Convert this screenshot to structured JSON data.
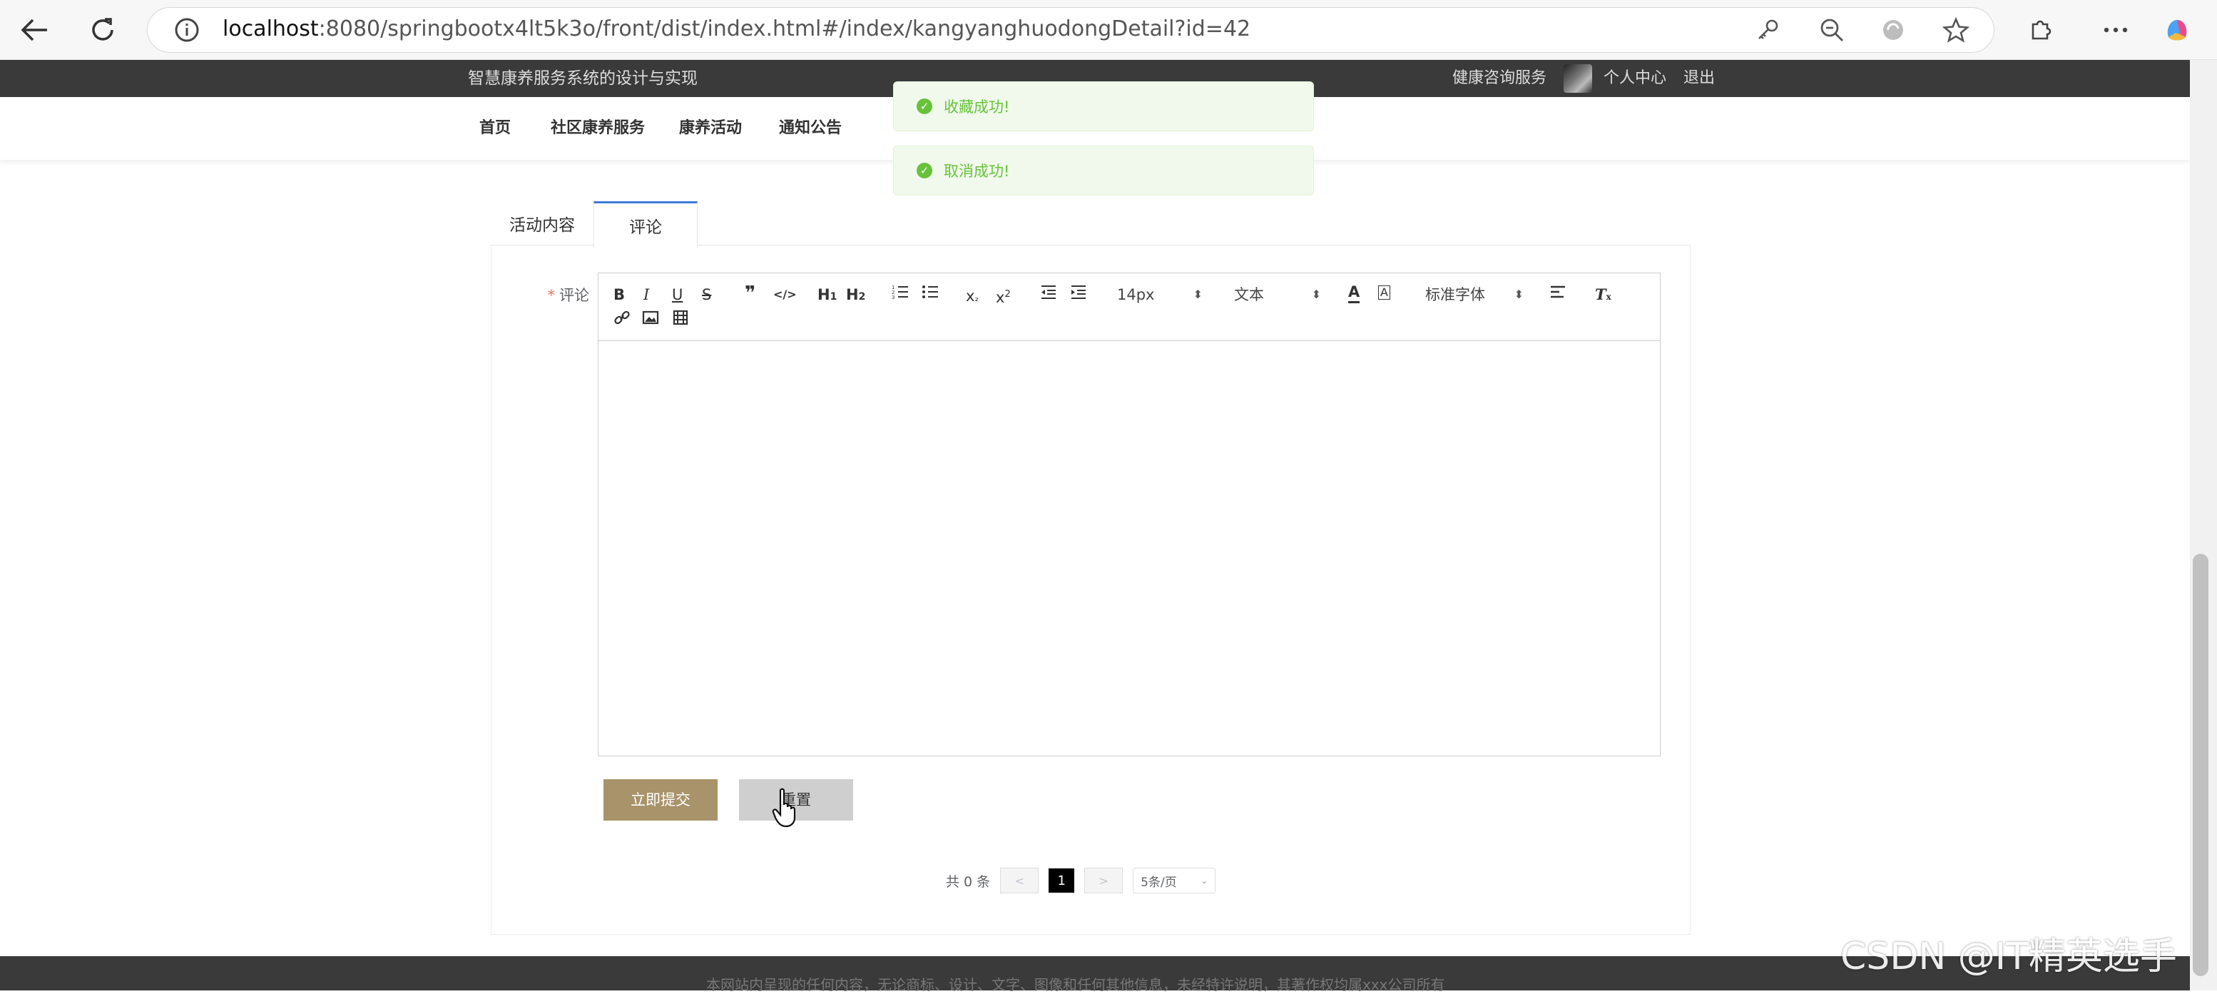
{
  "browser": {
    "url_host": "localhost",
    "url_rest": ":8080/springbootx4lt5k3o/front/dist/index.html#/index/kangyanghuodongDetail?id=42",
    "icons": [
      "back-icon",
      "reload-icon",
      "info-icon",
      "key-icon",
      "zoom-out-icon",
      "refresh-app-icon",
      "star-icon",
      "extensions-icon",
      "more-icon",
      "copilot-icon"
    ]
  },
  "site": {
    "title": "智慧康养服务系统的设计与实现",
    "header_right": {
      "consult": "健康咨询服务",
      "profile": "个人中心",
      "logout": "退出"
    },
    "nav": [
      "首页",
      "社区康养服务",
      "康养活动",
      "通知公告"
    ]
  },
  "toasts": [
    "收藏成功!",
    "取消成功!"
  ],
  "tabs": {
    "content": "活动内容",
    "comment": "评论"
  },
  "form": {
    "label": "评论",
    "required_mark": "*",
    "toolbar": {
      "font_size": "14px",
      "header": "文本",
      "font_family": "标准字体"
    },
    "submit": "立即提交",
    "reset": "重置"
  },
  "pagination": {
    "total": "共 0 条",
    "prev": "<",
    "current": "1",
    "next": ">",
    "page_size": "5条/页"
  },
  "footer": {
    "text": "本网站内呈现的任何内容，无论商标、设计、文字、图像和任何其他信息，未经特许说明，其著作权均属xxx公司所有"
  },
  "watermark": "CSDN @IT精英选手",
  "colors": {
    "accent": "#a8936a",
    "topbar": "#3a3a3a",
    "success": "#67c23a",
    "tab_active": "#3d7bd6"
  }
}
